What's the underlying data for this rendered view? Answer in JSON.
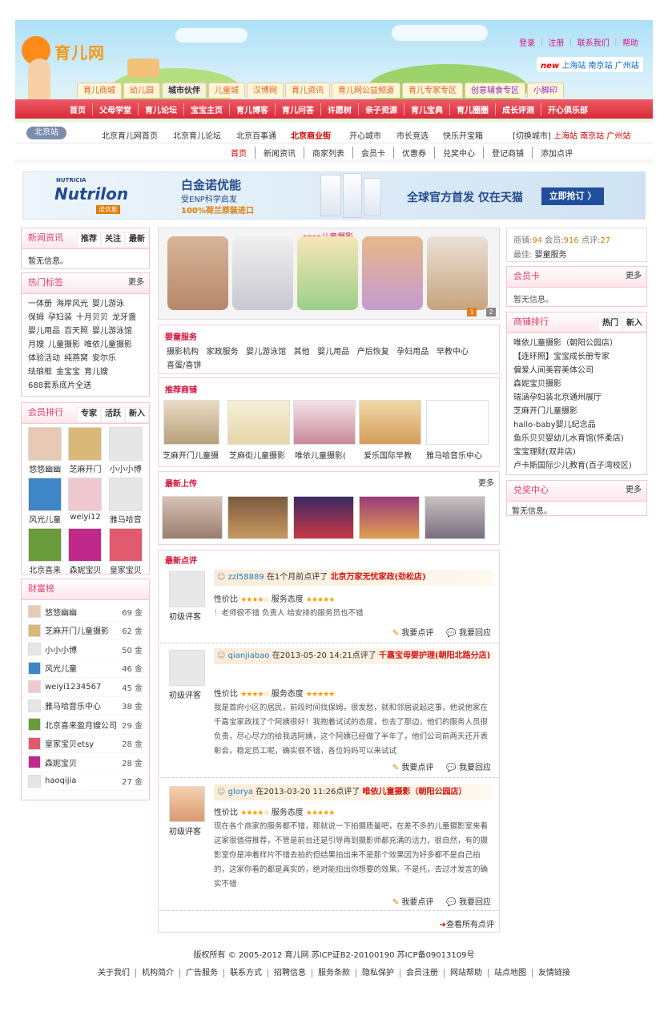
{
  "header": {
    "logo": "育儿网",
    "toplinks": [
      "登录",
      "注册",
      "联系我们",
      "帮助"
    ],
    "city_new": "new",
    "cities": [
      "上海站",
      "南京站",
      "广州站"
    ],
    "tabs": [
      "育儿商城",
      "幼儿园",
      "城市伙伴",
      "儿童城",
      "汉博网",
      "育儿资讯",
      "育儿网公益频道",
      "育儿专家专区",
      "创意辅食专区",
      "小脚印"
    ],
    "mainnav": [
      "首页",
      "父母学堂",
      "育儿论坛",
      "宝宝主页",
      "育儿博客",
      "育儿问答",
      "许愿树",
      "亲子资源",
      "育儿宝典",
      "育儿圈圈",
      "成长评测",
      "开心俱乐部"
    ]
  },
  "subnav": {
    "station": "北京站",
    "links": [
      "北京育儿网首页",
      "北京育儿论坛",
      "北京百事通",
      "北京商业街",
      "开心城市",
      "市长竞选",
      "快乐开宝箱"
    ],
    "switch_label": "[切换城市]",
    "switch_cities": [
      "上海站",
      "南京站",
      "广州站"
    ],
    "bizmenu": [
      "首页",
      "新闻资讯",
      "商家列表",
      "会员卡",
      "优惠券",
      "兑奖中心",
      "登记商铺",
      "添加点评"
    ]
  },
  "banner": {
    "brand": "Nutrilon",
    "brand_top": "NUTRICIA",
    "brand_cn": "诺优能",
    "title": "白金诺优能",
    "sub1": "受ENP科学启发",
    "sub2": "100%荷兰原装进口",
    "slogan": "全球官方首发 仅在天猫",
    "button": "立即抢订 〉"
  },
  "left": {
    "news": {
      "title": "新闻资讯",
      "tabs": [
        "推荐",
        "关注",
        "最新"
      ],
      "empty": "暂无信息。"
    },
    "tags": {
      "title": "热门标签",
      "more": "更多",
      "items": [
        "一体册",
        "海岸风光",
        "婴儿游泳",
        "保姆",
        "孕妇装",
        "十月贝贝",
        "龙牙盏",
        "婴儿用品",
        "百天照",
        "婴儿游泳馆",
        "月嫂",
        "儿童摄影",
        "唯依儿童摄影",
        "体验活动",
        "纯燕窝",
        "安尔乐",
        "珐琅框",
        "金宝宝",
        "育儿嫂",
        "688套系底片全送"
      ]
    },
    "members": {
      "title": "会员排行",
      "tabs": [
        "专家",
        "活跃",
        "新入"
      ],
      "items": [
        "悠悠幽幽",
        "芝麻开门",
        "小小小博",
        "风光儿童",
        "weiyi12",
        "雅马哈音",
        "北京喜来",
        "森妮宝贝",
        "皇家宝贝"
      ]
    },
    "wealth": {
      "title": "财富榜",
      "rows": [
        {
          "name": "悠悠幽幽",
          "pts": "69 金"
        },
        {
          "name": "芝麻开门儿童摄影",
          "pts": "62 金"
        },
        {
          "name": "小小小博",
          "pts": "50 金"
        },
        {
          "name": "风光儿童",
          "pts": "46 金"
        },
        {
          "name": "weiyi1234567",
          "pts": "45 金"
        },
        {
          "name": "雅马哈音乐中心",
          "pts": "38 金"
        },
        {
          "name": "北京喜来盈月嫂公司",
          "pts": "29 金"
        },
        {
          "name": "皇家宝贝etsy",
          "pts": "28 金"
        },
        {
          "name": "森妮宝贝",
          "pts": "28 金"
        },
        {
          "name": "haoqijia",
          "pts": "27 金"
        }
      ]
    }
  },
  "center": {
    "slider_title": "coco儿童摄影",
    "slider_pages": [
      "1",
      "2"
    ],
    "services": {
      "title": "婴童服务",
      "items": [
        "摄影机构",
        "家政服务",
        "婴儿游泳馆",
        "其他",
        "婴儿用品",
        "产后恢复",
        "孕妇用品",
        "早教中心",
        "喜蛋/喜饼"
      ]
    },
    "recommend": {
      "title": "推荐商铺",
      "items": [
        "芝麻开门儿童摄",
        "芝麻街儿童摄影",
        "唯依儿童摄影(",
        "爱乐国际早教",
        "雅马哈音乐中心"
      ]
    },
    "uploads": {
      "title": "最新上传",
      "more": "更多"
    },
    "reviews": {
      "title": "最新点评",
      "level": "初级评客",
      "price_label": "性价比",
      "service_label": "服务态度",
      "write": "我要点评",
      "reply": "我要回应",
      "view_all": "查看所有点评",
      "items": [
        {
          "user": "zzl58889",
          "time": "在1个月前点评了",
          "shop": "北京万家无忧家政(劲松店)",
          "body": "老师很不错 负责人 给安排的服务员也不错"
        },
        {
          "user": "qianjiabao",
          "time": "在2013-05-20 14:21点评了",
          "shop": "千嘉宝母婴护理(朝阳北路分店)",
          "body": "我是首府小区的居民，前段时间找保姆，很发愁，就和邻居说起这事，他说他家在千嘉宝家政找了个阿姨很好！我抱着试试的态度，也去了那边，他们的服务人员很负责，尽心尽力的给我选阿姨，这个阿姨已经做了半年了，他们公司前两天还开表彰会，稳定员工呢，确实很不错，各位妈妈可以来试试"
        },
        {
          "user": "glorya",
          "time": "在2013-03-20 11:26点评了",
          "shop": "唯依儿童摄影（朝阳公园店）",
          "body": "现在各个商家的服务都不错，那就说一下拍摄质量吧，在差不多的儿童摄影室来看这家很值得推荐，不管是前台还是引导再到摄影师都充满的活力，很自然，有的摄影室你是冲着样片不错去拍的但结果拍出来不是那个效果因为好多都不是自己拍的，这家你看的都是真实的，绝对能拍出你想要的效果。不是托，去过才发言的确实不错"
        }
      ]
    }
  },
  "right": {
    "stats": {
      "shops_label": "商铺:",
      "shops": "94",
      "members_label": "会员:",
      "members": "916",
      "reviews_label": "点评:",
      "reviews": "27",
      "best_label": "最佳:",
      "best": "婴童服务"
    },
    "card": {
      "title": "会员卡",
      "more": "更多",
      "empty": "暂无信息。"
    },
    "rank": {
      "title": "商铺排行",
      "tabs": [
        "热门",
        "新入"
      ],
      "items": [
        "唯依儿童摄影（朝阳公园店）",
        "【连环照】宝宝成长册专家",
        "偏爱人间美容美体公司",
        "森妮宝贝摄影",
        "瑞涵孕妇装北京通州展厅",
        "芝麻开门儿童摄影",
        "hallo-baby婴儿纪念品",
        "鱼乐贝贝婴幼儿水育馆(怀柔店)",
        "宝宝理财(双井店)",
        "卢卡斯国际少儿教育(百子湾校区)"
      ]
    },
    "prize": {
      "title": "兑奖中心",
      "more": "更多",
      "empty": "暂无信息。"
    }
  },
  "footer": {
    "copyright": "版权所有 © 2005-2012 育儿网 苏ICP证B2-20100190 苏ICP备09013109号",
    "links": [
      "关于我们",
      "机构简介",
      "广告服务",
      "联系方式",
      "招聘信息",
      "服务条款",
      "隐私保护",
      "会员注册",
      "网站帮助",
      "站点地图",
      "友情链接"
    ]
  }
}
